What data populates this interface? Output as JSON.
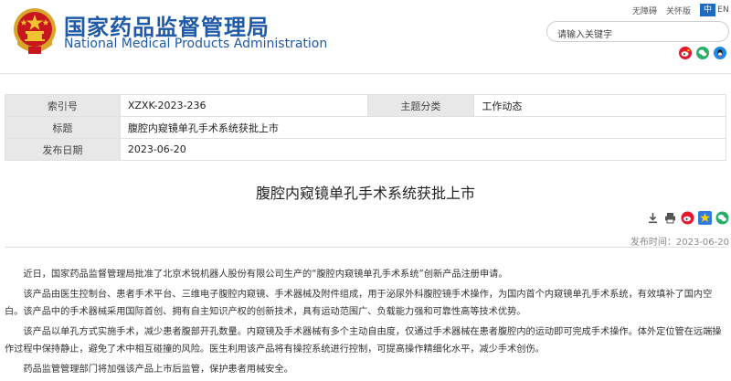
{
  "site": {
    "title_cn": "国家药品监督管理局",
    "title_en": "National Medical Products Administration"
  },
  "top_links": {
    "accessibility": "无障碍",
    "elder_mode": "关怀版",
    "lang_cn": "中",
    "lang_en": "EN"
  },
  "search": {
    "placeholder": "请输入关键字"
  },
  "share_icons": [
    "weibo-icon",
    "wechat-icon",
    "qq-icon"
  ],
  "meta": {
    "index_label": "索引号",
    "index_value": "XZXK-2023-236",
    "category_label": "主题分类",
    "category_value": "工作动态",
    "title_label": "标题",
    "title_value": "腹腔内窥镜单孔手术系统获批上市",
    "date_label": "发布日期",
    "date_value": "2023-06-20"
  },
  "article": {
    "title": "腹腔内窥镜单孔手术系统获批上市",
    "publish_time": "发布时间：2023-06-20",
    "paragraphs": [
      "近日，国家药品监督管理局批准了北京术锐机器人股份有限公司生产的“腹腔内窥镜单孔手术系统”创新产品注册申请。",
      "该产品由医生控制台、患者手术平台、三维电子腹腔内窥镜、手术器械及附件组成，用于泌尿外科腹腔镜手术操作，为国内首个内窥镜单孔手术系统，有效填补了国内空白。该产品中的手术器械采用国际首创、拥有自主知识产权的创新技术，具有运动范围广、负载能力强和可靠性高等技术优势。",
      "该产品以单孔方式实施手术，减少患者腹部开孔数量。内窥镜及手术器械有多个主动自由度，仅通过手术器械在患者腹腔内的运动即可完成手术操作。体外定位管在远端操作过程中保持静止，避免了术中相互碰撞的风险。医生利用该产品将有操控系统进行控制，可提高操作精细化水平，减少手术创伤。",
      "药品监管管理部门将加强该产品上市后监管，保护患者用械安全。"
    ]
  },
  "colors": {
    "brand_blue": "#1f5aa8",
    "lang_active": "#1f6bc1",
    "label_bg": "#e8e8e8"
  }
}
